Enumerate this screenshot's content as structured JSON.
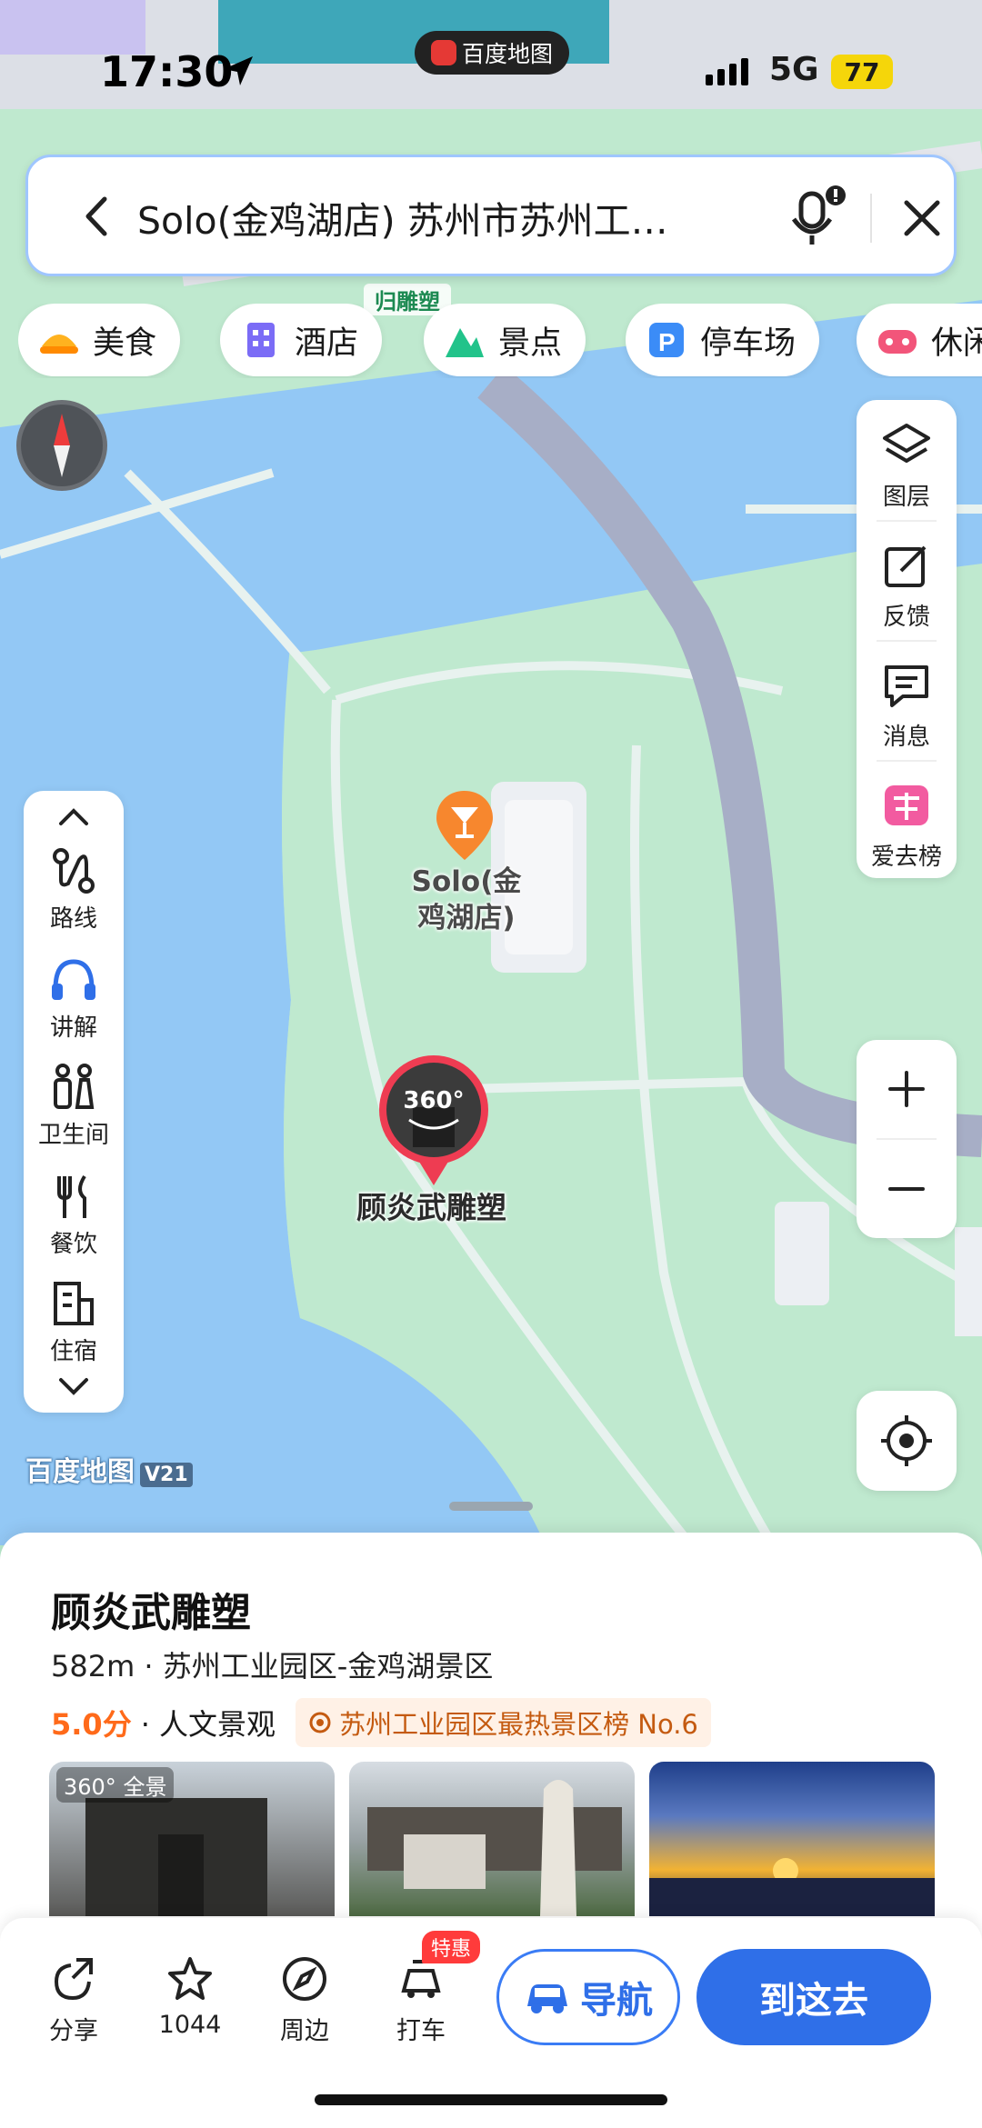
{
  "status_bar": {
    "time": "17:30",
    "app_name": "百度地图",
    "network": "5G",
    "battery": "77"
  },
  "search": {
    "query": "Solo(金鸡湖店) 苏州市苏州工…",
    "icons": [
      "back-icon",
      "mic-icon",
      "close-icon"
    ]
  },
  "categories": [
    {
      "label": "美食",
      "icon": "food-icon"
    },
    {
      "label": "酒店",
      "icon": "hotel-icon"
    },
    {
      "label": "景点",
      "icon": "scenic-icon"
    },
    {
      "label": "停车场",
      "icon": "parking-icon"
    },
    {
      "label": "休闲",
      "icon": "leisure-icon"
    }
  ],
  "right_toolbar": [
    {
      "label": "图层",
      "icon": "layers-icon"
    },
    {
      "label": "反馈",
      "icon": "feedback-icon"
    },
    {
      "label": "消息",
      "icon": "message-icon"
    },
    {
      "label": "爱去榜",
      "icon": "ranking-icon"
    }
  ],
  "left_toolbar": [
    {
      "label": "路线",
      "icon": "route-icon"
    },
    {
      "label": "讲解",
      "icon": "audio-guide-icon"
    },
    {
      "label": "卫生间",
      "icon": "toilet-icon"
    },
    {
      "label": "餐饮",
      "icon": "dining-icon"
    },
    {
      "label": "住宿",
      "icon": "lodging-icon"
    }
  ],
  "map": {
    "road_label": "归雕塑",
    "bar_marker_label": "Solo(金\n鸡湖店)",
    "sculpture_marker_label": "顾炎武雕塑",
    "pano_badge": "360°",
    "logo_text": "百度地图",
    "logo_version": "V21"
  },
  "place": {
    "name": "顾炎武雕塑",
    "distance_area": "582m · 苏州工业园区-金鸡湖景区",
    "score": "5.0分",
    "category": "· 人文景观",
    "rank": "苏州工业园区最热景区榜 No.6",
    "photo_tag": "全景"
  },
  "actions": {
    "share": "分享",
    "favorite_count": "1044",
    "nearby": "周边",
    "taxi": "打车",
    "taxi_badge": "特惠",
    "navigate": "导航",
    "go_here": "到这去"
  },
  "colors": {
    "accent": "#2f6fe8",
    "water": "#93c8f5",
    "green": "#bfe9cf",
    "road": "#a7aec6",
    "score": "#ff6a1a"
  }
}
